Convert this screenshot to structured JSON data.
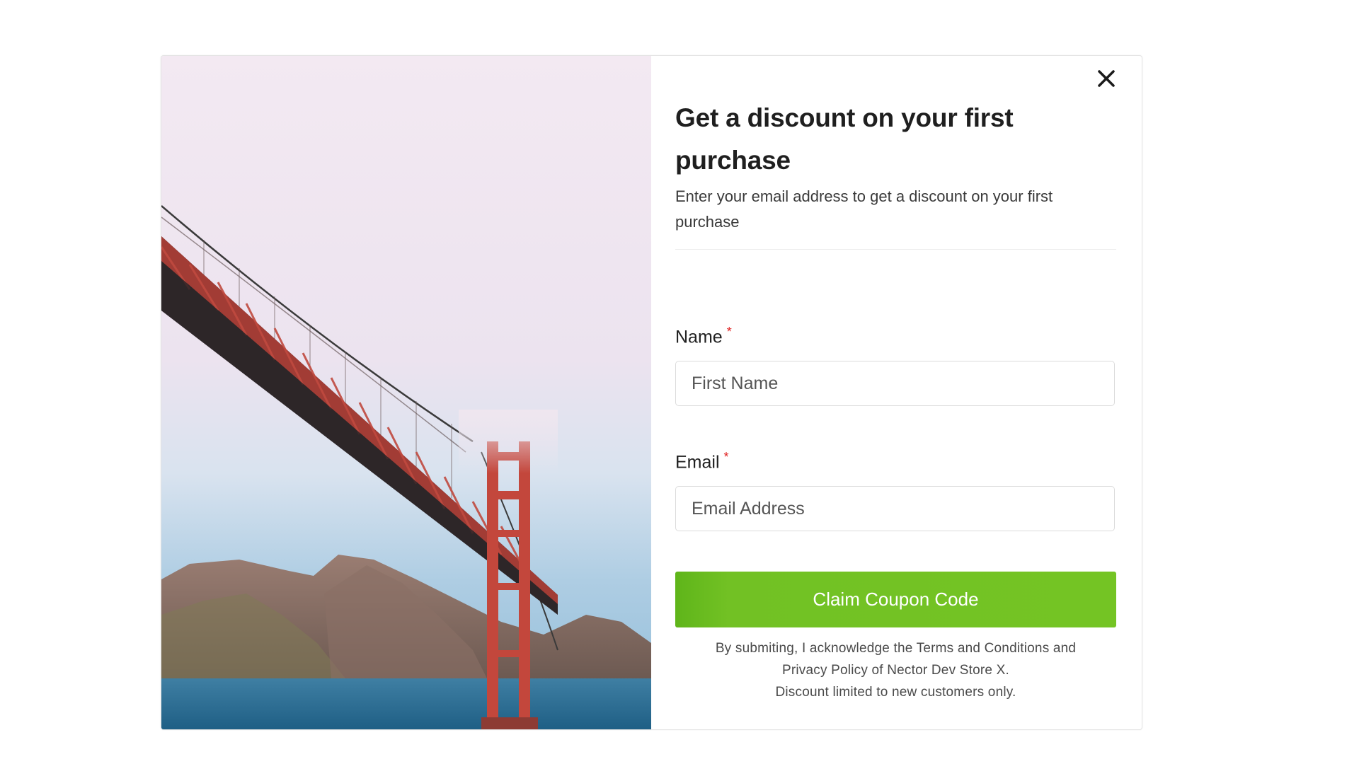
{
  "popup": {
    "title": "Get a discount on your first purchase",
    "subtitle": "Enter your email address to get a discount on your first purchase",
    "fields": {
      "name": {
        "label": "Name",
        "required_marker": "*",
        "placeholder": "First Name",
        "value": ""
      },
      "email": {
        "label": "Email",
        "required_marker": "*",
        "placeholder": "Email Address",
        "value": ""
      }
    },
    "submit_label": "Claim Coupon Code",
    "legal": {
      "line1": "By submiting, I acknowledge the Terms and Conditions and",
      "line2": "Privacy Policy of Nector Dev Store X.",
      "line3": "Discount limited to new customers only."
    },
    "close_icon": "close-icon"
  },
  "colors": {
    "button_green": "#74c424",
    "required_red": "#e02424",
    "title_text": "#1f1f1f"
  }
}
